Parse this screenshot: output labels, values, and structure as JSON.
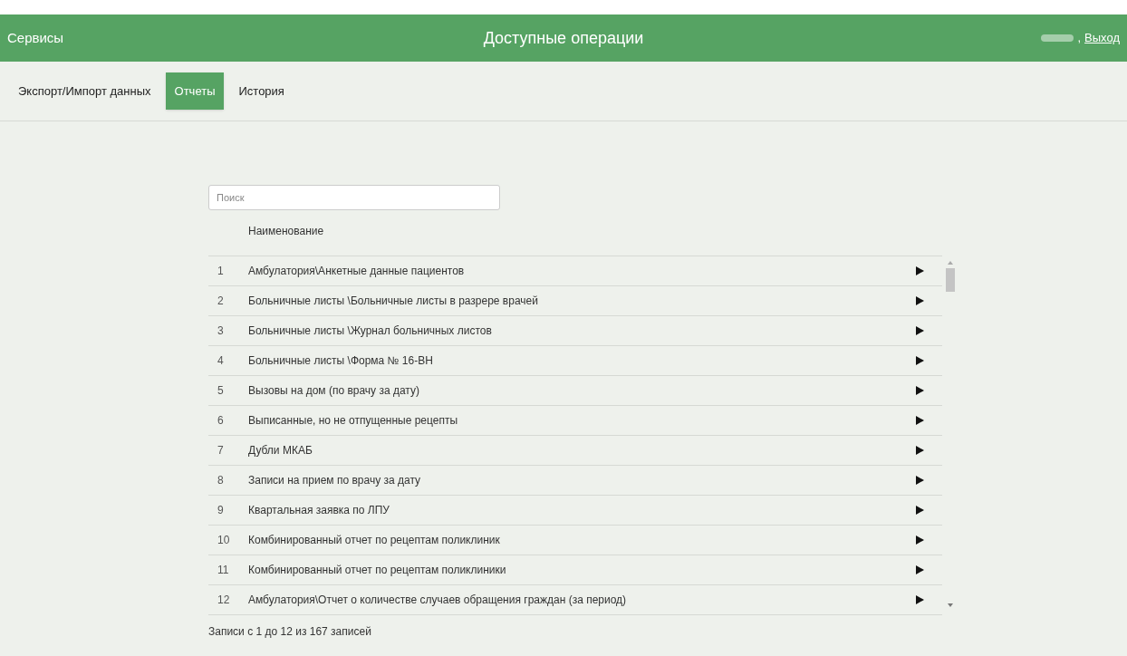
{
  "header": {
    "brand": "Сервисы",
    "title": "Доступные операции",
    "separator": ",",
    "logout": "Выход"
  },
  "tabs": [
    {
      "label": "Экспорт/Импорт данных",
      "selected": false
    },
    {
      "label": "Отчеты",
      "selected": true
    },
    {
      "label": "История",
      "selected": false
    }
  ],
  "search": {
    "placeholder": "Поиск"
  },
  "table": {
    "columns": [
      "Наименование"
    ],
    "rows": [
      {
        "number": "1",
        "name": "Амбулатория\\Анкетные данные пациентов"
      },
      {
        "number": "2",
        "name": "Больничные листы \\Больничные листы в разрере врачей"
      },
      {
        "number": "3",
        "name": "Больничные листы \\Журнал больничных листов"
      },
      {
        "number": "4",
        "name": "Больничные листы \\Форма № 16-ВН"
      },
      {
        "number": "5",
        "name": "Вызовы на дом (по врачу за дату)"
      },
      {
        "number": "6",
        "name": "Выписанные, но не отпущенные рецепты"
      },
      {
        "number": "7",
        "name": "Дубли МКАБ"
      },
      {
        "number": "8",
        "name": "Записи на прием по врачу за дату"
      },
      {
        "number": "9",
        "name": "Квартальная заявка по ЛПУ"
      },
      {
        "number": "10",
        "name": "Комбинированный отчет по рецептам поликлиник"
      },
      {
        "number": "11",
        "name": "Комбинированный отчет по рецептам поликлиники"
      },
      {
        "number": "12",
        "name": "Амбулатория\\Отчет о количестве случаев обращения граждан (за период)"
      }
    ]
  },
  "footer": "Записи с 1 до 12 из 167 записей"
}
